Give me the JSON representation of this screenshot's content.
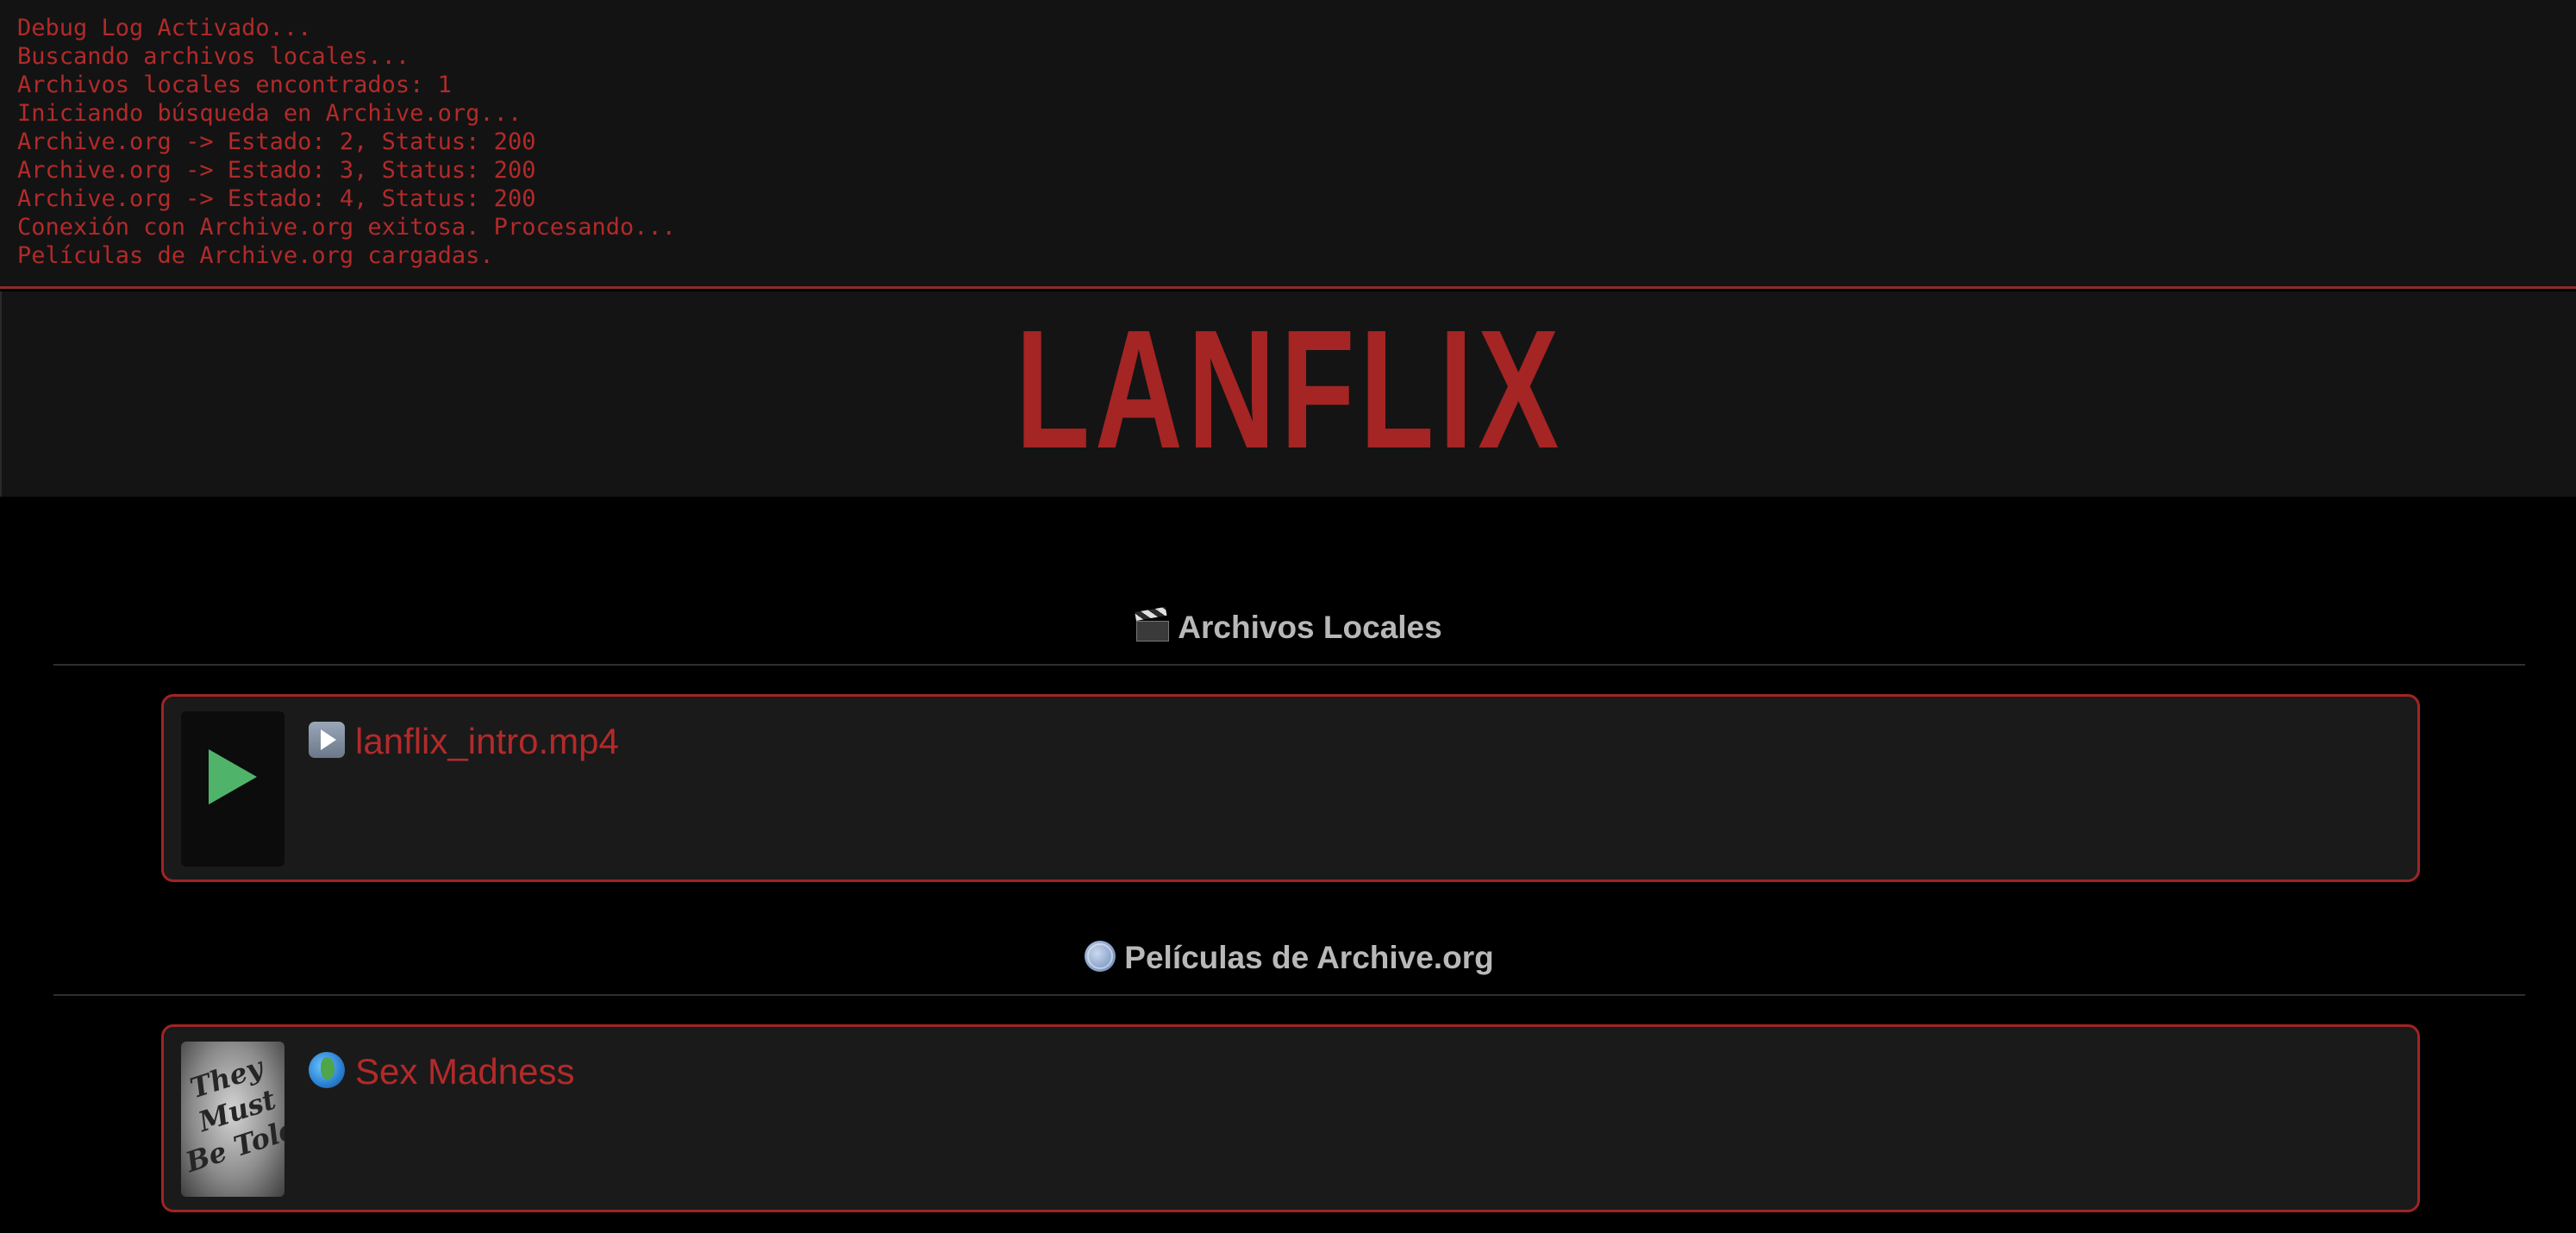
{
  "debug_log": {
    "lines": [
      "Debug Log Activado...",
      "Buscando archivos locales...",
      "Archivos locales encontrados: 1",
      "Iniciando búsqueda en Archive.org...",
      "Archive.org -> Estado: 2, Status: 200",
      "Archive.org -> Estado: 3, Status: 200",
      "Archive.org -> Estado: 4, Status: 200",
      "Conexión con Archive.org exitosa. Procesando...",
      "Películas de Archive.org cargadas."
    ]
  },
  "header": {
    "logo": "LANFLIX"
  },
  "sections": [
    {
      "icon": "clapperboard-icon",
      "title": "Archivos Locales",
      "items": [
        {
          "icon": "play-button-icon",
          "title": "lanflix_intro.mp4",
          "thumbnail": "play-thumbnail"
        }
      ]
    },
    {
      "icon": "globe-icon",
      "title": "Películas de Archive.org",
      "items": [
        {
          "icon": "earth-globe-icon",
          "title": "Sex Madness",
          "thumbnail": "poster-thumbnail",
          "poster_text": "They Must Be Told!"
        }
      ]
    }
  ],
  "colors": {
    "accent_red": "#a52424",
    "log_text": "#b22a2a",
    "card_background": "#1a1a1a",
    "play_green": "#4fb46a",
    "section_title": "#b8b8b8"
  }
}
